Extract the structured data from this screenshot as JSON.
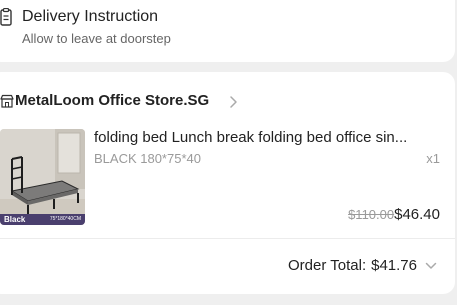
{
  "delivery": {
    "title": "Delivery Instruction",
    "subtitle": "Allow to leave at doorstep",
    "icon": "note-icon"
  },
  "store": {
    "name": "MetalLoom Office Store.SG",
    "icon": "store-icon"
  },
  "product": {
    "title": "folding bed Lunch break folding bed office sin...",
    "variant": "BLACK 180*75*40",
    "quantity": "x1",
    "original_price": "$110.00",
    "price": "$46.40",
    "thumbnail": {
      "color_label": "Black",
      "size_label": "75*180*40CM"
    }
  },
  "order": {
    "total_label": "Order Total:",
    "total_value": "$41.76"
  },
  "colors": {
    "background": "#efefef",
    "card": "#ffffff",
    "muted_text": "#9a9a9a",
    "thumb_label_bg": "#4a3f6e"
  }
}
